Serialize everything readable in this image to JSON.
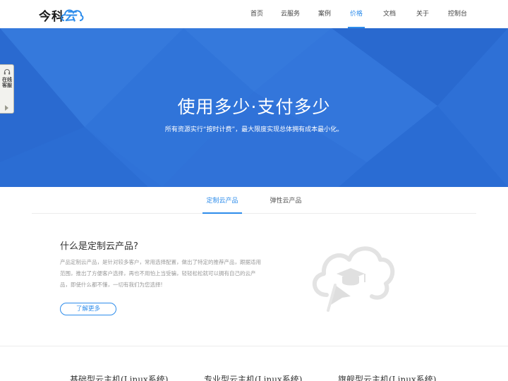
{
  "header": {
    "logo": {
      "text_main": "今科",
      "text_accent": "云"
    },
    "nav": [
      {
        "label": "首页",
        "active": false
      },
      {
        "label": "云服务",
        "active": false
      },
      {
        "label": "案例",
        "active": false
      },
      {
        "label": "价格",
        "active": true
      },
      {
        "label": "文档",
        "active": false
      },
      {
        "label": "关于",
        "active": false
      },
      {
        "label": "控制台",
        "active": false
      }
    ]
  },
  "hero": {
    "title": "使用多少·支付多少",
    "subtitle": "所有资源实行“按时计费”，最大限度实现总体拥有成本最小化。"
  },
  "side_service": {
    "label": "在线客服",
    "icon": "headset-icon"
  },
  "tabs": [
    {
      "label": "定制云产品",
      "active": true
    },
    {
      "label": "弹性云产品",
      "active": false
    }
  ],
  "intro": {
    "title": "什么是定制云产品?",
    "description": "产品定制云产品，是针对较多客户，常用选择配置，做出了特定的推荐产品，跟据适用范围，推出了方便客户选择，再也不用怕上当受骗，轻轻松松就可以拥有自己的云产品，即使什么都不懂，一切有我们为您选择!",
    "more_label": "了解更多",
    "illustration_icon": "cloud-graduation-cap-cursor-icon"
  },
  "products": [
    {
      "title": "基础型云主机(Linux系统)"
    },
    {
      "title": "专业型云主机(Linux系统)"
    },
    {
      "title": "旗舰型云主机(Linux系统)"
    }
  ],
  "colors": {
    "accent": "#2d8ceb",
    "hero_bg": "#2f72d8"
  }
}
